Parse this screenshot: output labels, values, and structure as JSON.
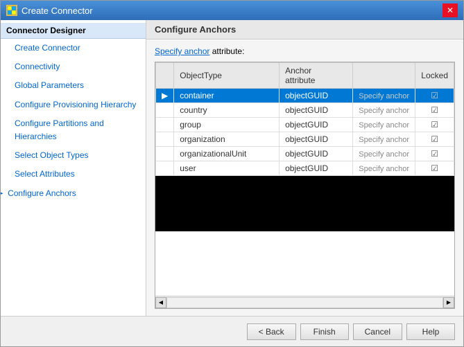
{
  "window": {
    "title": "Create Connector",
    "close_label": "✕"
  },
  "sidebar": {
    "header": "Connector Designer",
    "items": [
      {
        "label": "Create Connector",
        "indent": false,
        "active": false,
        "arrow": false
      },
      {
        "label": "Connectivity",
        "indent": true,
        "active": false,
        "arrow": false
      },
      {
        "label": "Global Parameters",
        "indent": true,
        "active": false,
        "arrow": false
      },
      {
        "label": "Configure Provisioning Hierarchy",
        "indent": true,
        "active": false,
        "arrow": false
      },
      {
        "label": "Configure Partitions and Hierarchies",
        "indent": true,
        "active": false,
        "arrow": false
      },
      {
        "label": "Select Object Types",
        "indent": true,
        "active": false,
        "arrow": false
      },
      {
        "label": "Select Attributes",
        "indent": true,
        "active": false,
        "arrow": false
      },
      {
        "label": "Configure Anchors",
        "indent": true,
        "active": true,
        "arrow": true
      }
    ]
  },
  "main": {
    "header": "Configure Anchors",
    "specify_anchor_text_before": "Specify anchor",
    "specify_anchor_text_after": " attribute:",
    "table": {
      "columns": [
        {
          "label": "",
          "key": "arrow"
        },
        {
          "label": "ObjectType",
          "key": "objectType"
        },
        {
          "label": "Anchor attribute",
          "key": "anchorAttribute"
        },
        {
          "label": "",
          "key": "specifyBtn"
        },
        {
          "label": "Locked",
          "key": "locked"
        }
      ],
      "rows": [
        {
          "arrow": "▶",
          "objectType": "container",
          "anchorAttribute": "objectGUID",
          "specifyBtn": "Specify anchor",
          "locked": true,
          "selected": true
        },
        {
          "arrow": "",
          "objectType": "country",
          "anchorAttribute": "objectGUID",
          "specifyBtn": "Specify anchor",
          "locked": true,
          "selected": false
        },
        {
          "arrow": "",
          "objectType": "group",
          "anchorAttribute": "objectGUID",
          "specifyBtn": "Specify anchor",
          "locked": true,
          "selected": false
        },
        {
          "arrow": "",
          "objectType": "organization",
          "anchorAttribute": "objectGUID",
          "specifyBtn": "Specify anchor",
          "locked": true,
          "selected": false
        },
        {
          "arrow": "",
          "objectType": "organizationalUnit",
          "anchorAttribute": "objectGUID",
          "specifyBtn": "Specify anchor",
          "locked": true,
          "selected": false
        },
        {
          "arrow": "",
          "objectType": "user",
          "anchorAttribute": "objectGUID",
          "specifyBtn": "Specify anchor",
          "locked": true,
          "selected": false
        }
      ]
    }
  },
  "footer": {
    "back_label": "< Back",
    "finish_label": "Finish",
    "cancel_label": "Cancel",
    "help_label": "Help"
  }
}
